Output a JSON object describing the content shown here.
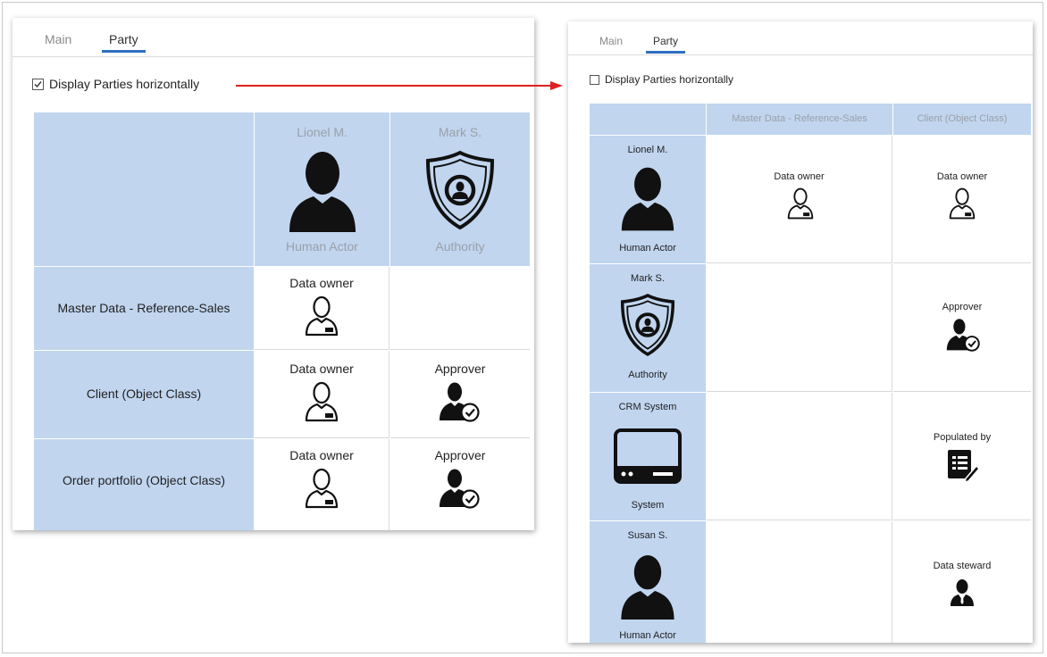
{
  "left": {
    "tabs": [
      {
        "label": "Main"
      },
      {
        "label": "Party"
      }
    ],
    "active_tab": "Party",
    "checkbox": {
      "label": "Display Parties horizontally",
      "checked": true
    },
    "parties": [
      {
        "name": "Lionel M.",
        "type": "Human Actor",
        "icon": "human-actor-icon"
      },
      {
        "name": "Mark S.",
        "type": "Authority",
        "icon": "authority-shield-icon"
      }
    ],
    "objects": [
      {
        "name": "Master Data - Reference-Sales",
        "cells": [
          "Data owner",
          ""
        ]
      },
      {
        "name": "Client (Object Class)",
        "cells": [
          "Data owner",
          "Approver"
        ]
      },
      {
        "name": "Order portfolio (Object Class)",
        "cells": [
          "Data owner",
          "Approver"
        ]
      }
    ]
  },
  "right": {
    "tabs": [
      {
        "label": "Main"
      },
      {
        "label": "Party"
      }
    ],
    "active_tab": "Party",
    "checkbox": {
      "label": "Display Parties horizontally",
      "checked": false
    },
    "columns": [
      "Master Data - Reference-Sales",
      "Client (Object Class)"
    ],
    "parties": [
      {
        "name": "Lionel M.",
        "type": "Human Actor",
        "icon": "human-actor-icon",
        "cells": [
          "Data owner",
          "Data owner"
        ]
      },
      {
        "name": "Mark S.",
        "type": "Authority",
        "icon": "authority-shield-icon",
        "cells": [
          "",
          "Approver"
        ]
      },
      {
        "name": "CRM System",
        "type": "System",
        "icon": "system-monitor-icon",
        "cells": [
          "",
          "Populated by"
        ]
      },
      {
        "name": "Susan S.",
        "type": "Human Actor",
        "icon": "human-actor-icon",
        "cells": [
          "",
          "Data steward"
        ]
      }
    ]
  },
  "colors": {
    "header_blue": "#c1d5ef",
    "tab_accent": "#2e6fc0",
    "arrow": "#e02020",
    "grid": "#d9d9d9"
  }
}
